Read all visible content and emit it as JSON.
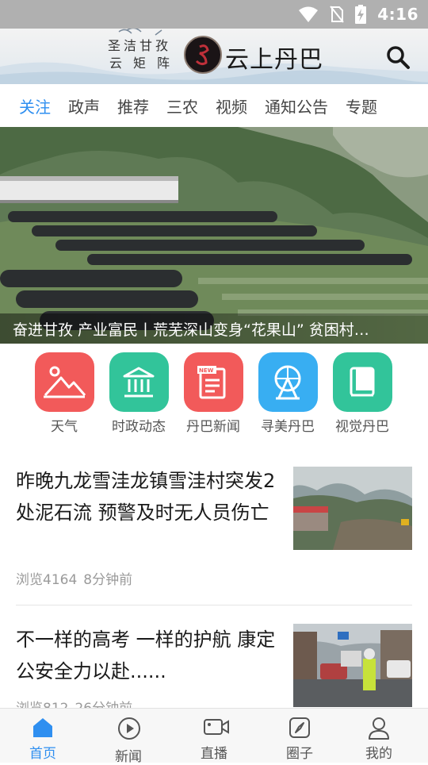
{
  "status_bar": {
    "time": "4:16",
    "icons": [
      "wifi-icon",
      "sim-off-icon",
      "battery-charging-icon"
    ]
  },
  "header": {
    "motto_line1": "圣洁甘孜",
    "motto_line2": "云矩阵",
    "app_title": "云上丹巴",
    "search_icon": "search-icon"
  },
  "tabs": [
    "关注",
    "政声",
    "推荐",
    "三农",
    "视频",
    "通知公告",
    "专题"
  ],
  "active_tab": "关注",
  "hero": {
    "caption": "奋进甘孜 产业富民丨荒芜深山变身“花果山” 贫困村…",
    "slide_count": 5,
    "active_slide": 1
  },
  "quick_links": [
    {
      "label": "天气",
      "icon": "weather-mountain-icon",
      "color": "#f25a5a"
    },
    {
      "label": "时政动态",
      "icon": "government-building-icon",
      "color": "#32c49a"
    },
    {
      "label": "丹巴新闻",
      "icon": "news-paper-icon",
      "color": "#f25a5a"
    },
    {
      "label": "寻美丹巴",
      "icon": "ferris-wheel-icon",
      "color": "#38aef2"
    },
    {
      "label": "视觉丹巴",
      "icon": "book-icon",
      "color": "#32c49a"
    }
  ],
  "news": [
    {
      "title": "昨晚九龙雪洼龙镇雪洼村突发2处泥石流 预警及时无人员伤亡",
      "views": "浏览4164",
      "time": "8分钟前"
    },
    {
      "title": "不一样的高考 一样的护航 康定公安全力以赴......",
      "views": "浏览812",
      "time": "26分钟前"
    }
  ],
  "bottom_nav": [
    {
      "label": "首页",
      "icon": "home-icon",
      "active": true
    },
    {
      "label": "新闻",
      "icon": "play-circle-icon",
      "active": false
    },
    {
      "label": "直播",
      "icon": "video-camera-icon",
      "active": false
    },
    {
      "label": "圈子",
      "icon": "compass-icon",
      "active": false
    },
    {
      "label": "我的",
      "icon": "user-icon",
      "active": false
    }
  ],
  "colors": {
    "accent": "#2f8ff0",
    "tab_text": "#444444",
    "meta_text": "#9a9a9a"
  }
}
